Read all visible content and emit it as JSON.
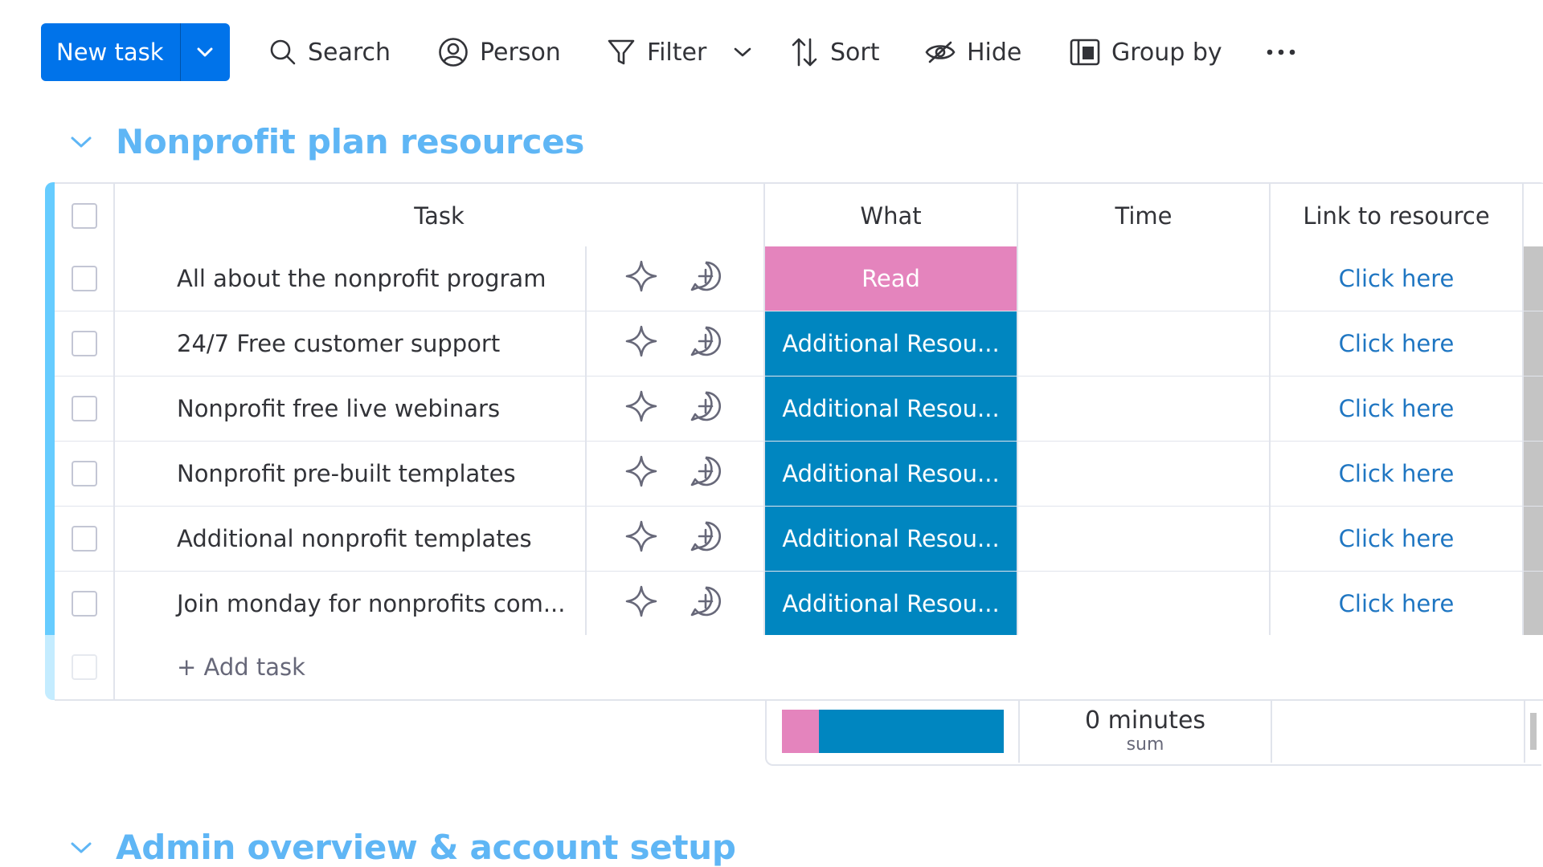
{
  "toolbar": {
    "new_task_label": "New task",
    "search_label": "Search",
    "person_label": "Person",
    "filter_label": "Filter",
    "sort_label": "Sort",
    "hide_label": "Hide",
    "group_by_label": "Group by",
    "more_icon": "more-horizontal-icon"
  },
  "groups": [
    {
      "title": "Nonprofit plan resources",
      "color": "#5fb6f5"
    },
    {
      "title": "Admin overview & account setup",
      "color": "#5fb6f5"
    }
  ],
  "table": {
    "columns": [
      "Task",
      "What",
      "Time",
      "Link to resource"
    ],
    "rows": [
      {
        "task": "All about the nonprofit program",
        "what": "Read",
        "what_color": "#e484bd",
        "time": "",
        "link": "Click here"
      },
      {
        "task": "24/7 Free customer support",
        "what": "Additional Resou...",
        "what_color": "#0086c0",
        "time": "",
        "link": "Click here"
      },
      {
        "task": "Nonprofit free live webinars",
        "what": "Additional Resou...",
        "what_color": "#0086c0",
        "time": "",
        "link": "Click here"
      },
      {
        "task": "Nonprofit pre-built templates",
        "what": "Additional Resou...",
        "what_color": "#0086c0",
        "time": "",
        "link": "Click here"
      },
      {
        "task": "Additional nonprofit templates",
        "what": "Additional Resou...",
        "what_color": "#0086c0",
        "time": "",
        "link": "Click here"
      },
      {
        "task": "Join monday for nonprofits com...",
        "what": "Additional Resou...",
        "what_color": "#0086c0",
        "time": "",
        "link": "Click here"
      }
    ],
    "add_task_label": "+ Add task",
    "summary": {
      "what_distribution": {
        "Read": 1,
        "Additional Resou...": 5
      },
      "time_value": "0 minutes",
      "time_label": "sum"
    }
  },
  "colors": {
    "primary": "#0073ea",
    "group": "#66ccff",
    "read": "#e484bd",
    "additional": "#0086c0",
    "link": "#1f76c2"
  }
}
